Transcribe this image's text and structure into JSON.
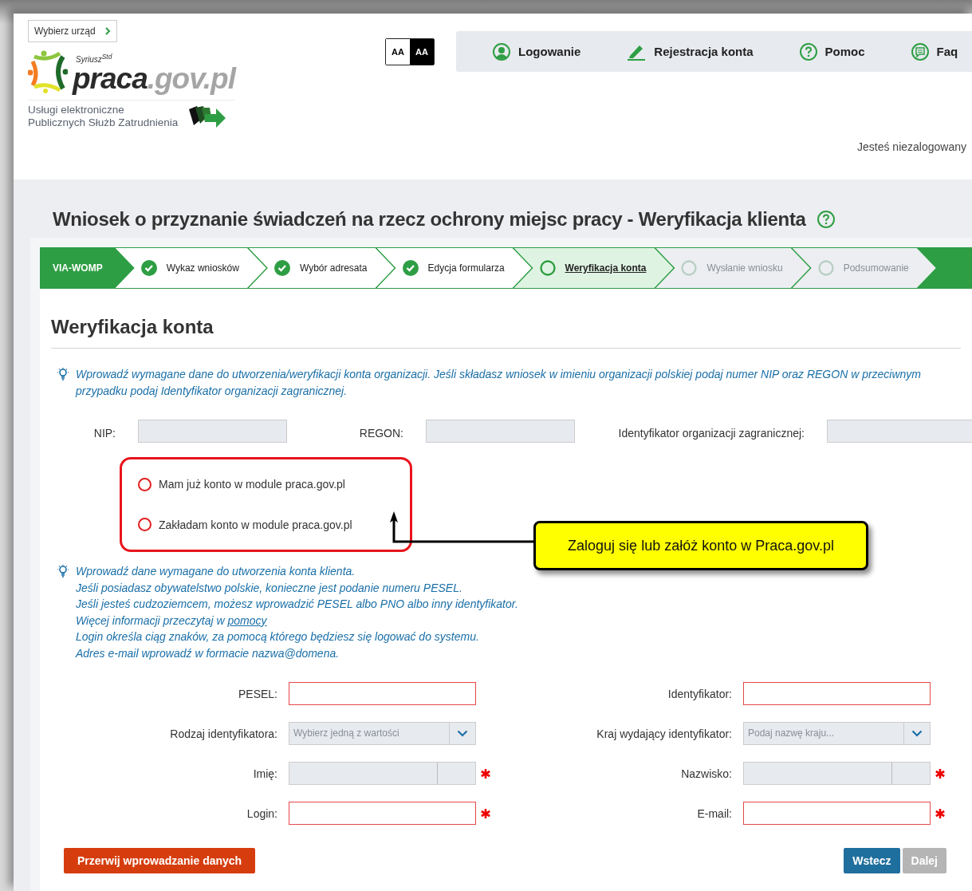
{
  "header": {
    "office_button": "Wybierz urząd",
    "logo": {
      "superscript": "Syriusz$^{Std}$",
      "main": "praca",
      "suffix": ".gov.pl"
    },
    "tagline": [
      "Usługi elektroniczne",
      "Publicznych Służb Zatrudnienia"
    ],
    "contrast_buttons": [
      {
        "label": "AA",
        "kind": "normal"
      },
      {
        "label": "AA",
        "kind": "high"
      }
    ],
    "nav": [
      {
        "label": "Logowanie",
        "kind": "user"
      },
      {
        "label": "Rejestracja konta",
        "kind": "pencil"
      },
      {
        "label": "Pomoc",
        "kind": "question"
      },
      {
        "label": "Faq",
        "kind": "chat"
      }
    ],
    "login_status": "Jesteś niezalogowany"
  },
  "page_title": "Wniosek o przyznanie świadczeń na rzecz ochrony miejsc pracy - Weryfikacja klienta",
  "steps": {
    "badge": "VIA-WOMP",
    "items": [
      {
        "label": "Wykaz wniosków",
        "kind": "done"
      },
      {
        "label": "Wybór adresata",
        "kind": "done"
      },
      {
        "label": "Edycja formularza",
        "kind": "done"
      },
      {
        "label": "Weryfikacja konta",
        "kind": "current"
      },
      {
        "label": "Wysłanie wniosku",
        "kind": "pending"
      },
      {
        "label": "Podsumowanie",
        "kind": "pending"
      }
    ]
  },
  "section_title": "Weryfikacja konta",
  "org_hint": "Wprowadź wymagane dane do utworzenia/weryfikacji konta organizacji. Jeśli składasz wniosek w imieniu organizacji polskiej podaj numer NIP oraz REGON w przeciwnym przypadku podaj Identyfikator organizacji zagranicznej.",
  "org_fields": [
    {
      "label": "NIP:",
      "disabled": true
    },
    {
      "label": "REGON:",
      "disabled": true
    },
    {
      "label": "Identyfikator organizacji zagranicznej:",
      "disabled": true
    }
  ],
  "account_options": [
    {
      "label": "Mam już konto w module praca.gov.pl",
      "selected": false
    },
    {
      "label": "Zakładam konto w module praca.gov.pl",
      "selected": false
    }
  ],
  "callout": "Zaloguj się lub załóż konto w Praca.gov.pl",
  "client_hint": [
    {
      "text": "Wprowadź dane wymagane do utworzenia konta klienta."
    },
    {
      "text": "Jeśli posiadasz obywatelstwo polskie, konieczne jest podanie numeru PESEL."
    },
    {
      "text": "Jeśli jesteś cudzoziemcem, możesz wprowadzić PESEL albo PNO albo inny identyfikator."
    },
    {
      "text": "Więcej informacji przeczytaj w",
      "link": "pomocy"
    },
    {
      "text": "Login określa ciąg znaków, za pomocą którego będziesz się logować do systemu."
    },
    {
      "text": "Adres e-mail wprowadź w formacie nazwa@domena."
    }
  ],
  "client_fields": [
    {
      "label": "PESEL:",
      "kind": "text",
      "invalid": true,
      "required": false
    },
    {
      "label": "Identyfikator:",
      "kind": "text",
      "invalid": true,
      "required": false
    },
    {
      "label": "Rodzaj identyfikatora:",
      "kind": "select",
      "placeholder": "Wybierz jedną z wartości",
      "required": false
    },
    {
      "label": "Kraj wydający identyfikator:",
      "kind": "select",
      "placeholder": "Podaj nazwę kraju...",
      "required": false
    },
    {
      "label": "Imię:",
      "kind": "split",
      "required": true
    },
    {
      "label": "Nazwisko:",
      "kind": "split",
      "required": true
    },
    {
      "label": "Login:",
      "kind": "text",
      "invalid": true,
      "required": true
    },
    {
      "label": "E-mail:",
      "kind": "text",
      "invalid": true,
      "required": true
    }
  ],
  "buttons": {
    "cancel": "Przerwij wprowadzanie danych",
    "back": "Wstecz",
    "next": {
      "label": "Dalej",
      "disabled": true
    }
  }
}
